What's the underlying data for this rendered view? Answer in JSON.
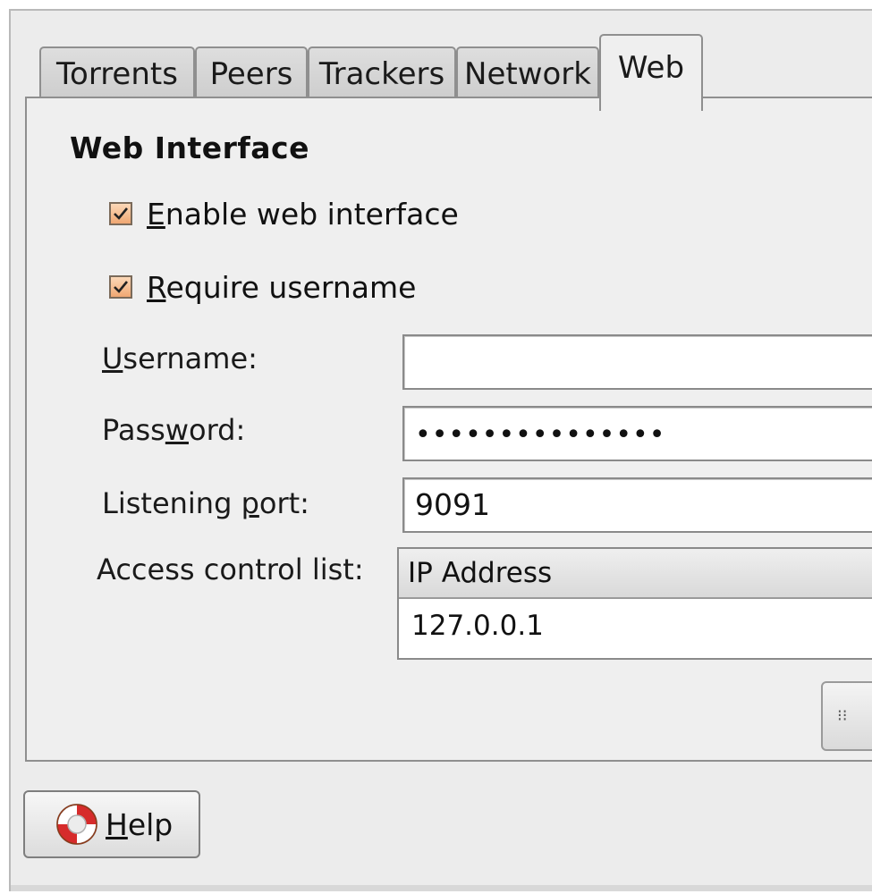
{
  "tabs": [
    "Torrents",
    "Peers",
    "Trackers",
    "Network",
    "Web"
  ],
  "active_tab": "Web",
  "section": {
    "title": "Web Interface"
  },
  "options": {
    "enable_web": {
      "label_accel": "E",
      "label_rest": "nable web interface",
      "checked": true
    },
    "require_username": {
      "label_accel": "R",
      "label_rest": "equire username",
      "checked": true
    }
  },
  "fields": {
    "username": {
      "label_pre": "",
      "label_accel": "U",
      "label_post": "sername:",
      "value": ""
    },
    "password": {
      "label_pre": "Pass",
      "label_accel": "w",
      "label_post": "ord:",
      "value": "•••••••••••••••"
    },
    "port": {
      "label_pre": "Listening ",
      "label_accel": "p",
      "label_post": "ort:",
      "value": "9091"
    }
  },
  "acl": {
    "label": "Access control list:",
    "column_header": "IP Address",
    "rows": [
      "127.0.0.1"
    ]
  },
  "buttons": {
    "side_button_glyph": "⁝⁝",
    "help_accel": "H",
    "help_rest": "elp"
  },
  "colors": {
    "checkbox_fill": "#f0a772",
    "dialog_bg": "#ececec"
  },
  "icons": {
    "help": "life-ring-icon",
    "checkmark": "checkmark-icon"
  }
}
